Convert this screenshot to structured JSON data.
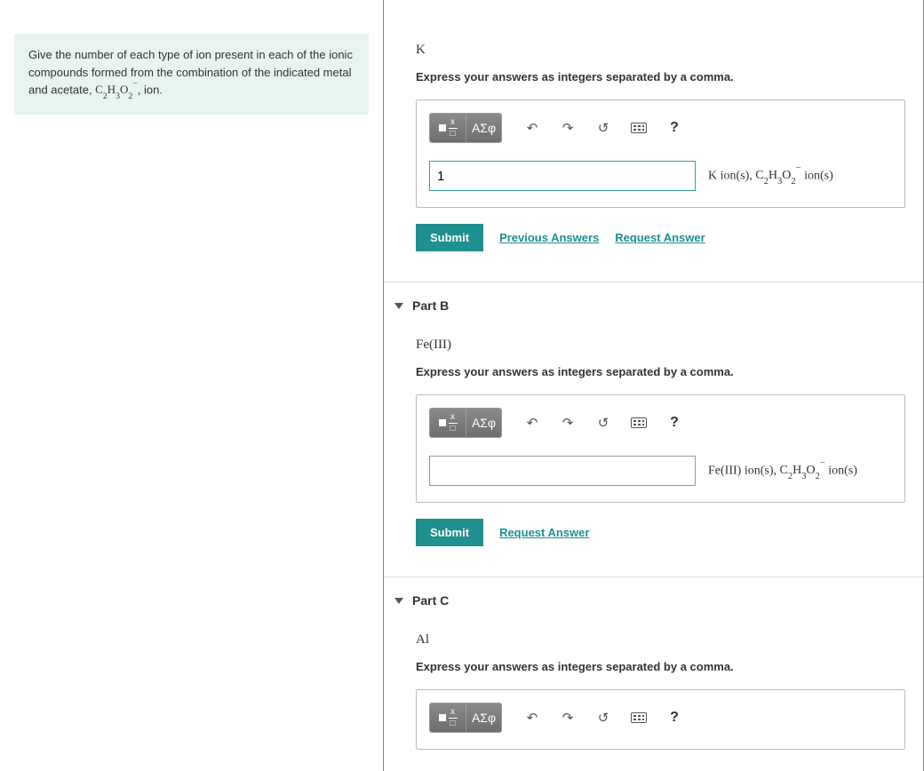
{
  "question": {
    "prefix": "Give the number of each type of ion present in each of the ionic compounds formed from the combination of the indicated metal and acetate, ",
    "formula_html": "C<sub>2</sub>H<sub>3</sub>O<sub>2</sub><sup>&minus;</sup>",
    "suffix": ", ion."
  },
  "common": {
    "instructions": "Express your answers as integers separated by a comma.",
    "submit": "Submit",
    "previous_answers": "Previous Answers",
    "request_answer": "Request Answer",
    "greek": "ΑΣφ",
    "help": "?"
  },
  "partA": {
    "prompt": "K",
    "value": "1",
    "unit_prefix": "K",
    "acetate_html": "C<sub>2</sub>H<sub>3</sub>O<sub>2</sub><sup>&minus;</sup>",
    "unit_mid": " ion(s), ",
    "unit_suffix": " ion(s)"
  },
  "partB": {
    "header": "Part B",
    "prompt": "Fe(III)",
    "value": "",
    "unit_prefix": "Fe(III)",
    "acetate_html": "C<sub>2</sub>H<sub>3</sub>O<sub>2</sub><sup>&minus;</sup>",
    "unit_mid": " ion(s), ",
    "unit_suffix": " ion(s)"
  },
  "partC": {
    "header": "Part C",
    "prompt": "Al"
  }
}
